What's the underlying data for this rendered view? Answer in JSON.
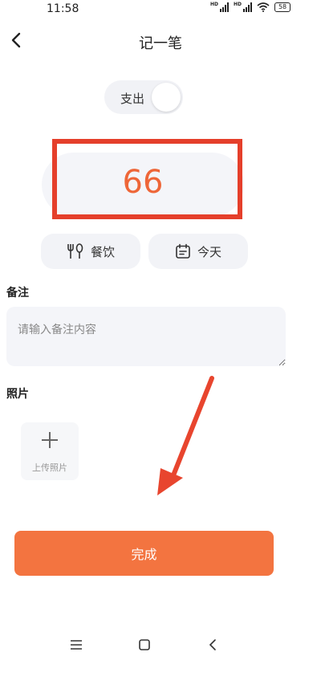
{
  "status_bar": {
    "time": "11:58",
    "signal_label": "HD",
    "battery": "58"
  },
  "header": {
    "title": "记一笔",
    "back_icon": "chevron-left-icon"
  },
  "type_toggle": {
    "label": "支出"
  },
  "amount": {
    "value": "66",
    "color": "#ee6638"
  },
  "category": {
    "label": "餐饮",
    "icon": "utensils-icon"
  },
  "date": {
    "label": "今天",
    "icon": "calendar-icon"
  },
  "note": {
    "label": "备注",
    "placeholder": "请输入备注内容",
    "value": ""
  },
  "photos": {
    "label": "照片",
    "upload_label": "上传照片"
  },
  "submit": {
    "label": "完成",
    "color": "#f37440"
  },
  "nav_bar": {
    "items": [
      "menu-icon",
      "home-icon",
      "back-icon"
    ]
  },
  "annotation": {
    "highlight_color": "#e53f2b",
    "arrow_color": "#e8452e"
  }
}
